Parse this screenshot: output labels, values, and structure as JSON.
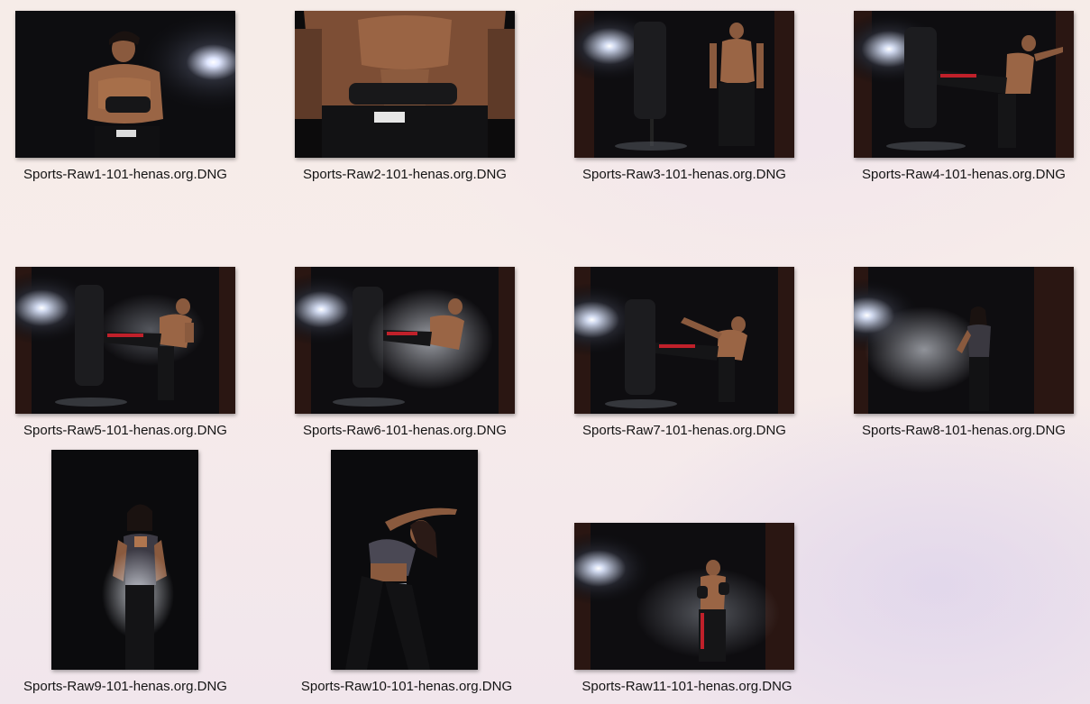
{
  "files": [
    {
      "name": "Sports-Raw1-101-henas.org.DNG",
      "thumb_icon": "boxer-wrapping-hands-photo"
    },
    {
      "name": "Sports-Raw2-101-henas.org.DNG",
      "thumb_icon": "boxer-torso-closeup-photo"
    },
    {
      "name": "Sports-Raw3-101-henas.org.DNG",
      "thumb_icon": "boxer-standing-by-bag-photo"
    },
    {
      "name": "Sports-Raw4-101-henas.org.DNG",
      "thumb_icon": "boxer-high-kick-photo"
    },
    {
      "name": "Sports-Raw5-101-henas.org.DNG",
      "thumb_icon": "boxer-side-kick-photo"
    },
    {
      "name": "Sports-Raw6-101-henas.org.DNG",
      "thumb_icon": "boxer-kick-chalk-cloud-photo"
    },
    {
      "name": "Sports-Raw7-101-henas.org.DNG",
      "thumb_icon": "boxer-roundhouse-kick-photo"
    },
    {
      "name": "Sports-Raw8-101-henas.org.DNG",
      "thumb_icon": "woman-chalk-dust-photo"
    },
    {
      "name": "Sports-Raw9-101-henas.org.DNG",
      "thumb_icon": "woman-clapping-chalk-photo"
    },
    {
      "name": "Sports-Raw10-101-henas.org.DNG",
      "thumb_icon": "woman-side-stretch-photo"
    },
    {
      "name": "Sports-Raw11-101-henas.org.DNG",
      "thumb_icon": "boxer-guard-stance-photo"
    }
  ]
}
